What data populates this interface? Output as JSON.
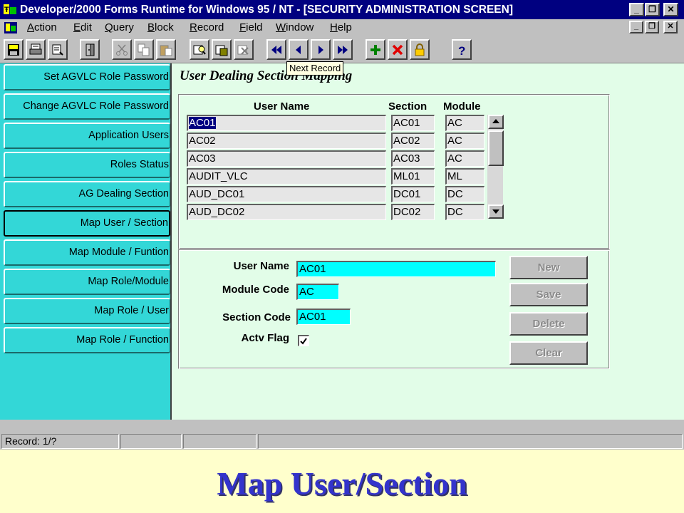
{
  "window": {
    "title": "Developer/2000 Forms Runtime for Windows 95 / NT - [SECURITY ADMINISTRATION SCREEN]",
    "app_icon": "forms-runtime-icon",
    "controls": [
      "minimize-icon",
      "restore-icon",
      "close-icon"
    ]
  },
  "menubar": {
    "items": [
      "Action",
      "Edit",
      "Query",
      "Block",
      "Record",
      "Field",
      "Window",
      "Help"
    ]
  },
  "toolbar": {
    "icons": [
      "save-icon",
      "print-icon",
      "print-setup-icon",
      "exit-icon",
      "cut-icon",
      "copy-icon",
      "paste-icon",
      "enter-query-icon",
      "execute-query-icon",
      "cancel-query-icon",
      "first-record-icon",
      "previous-record-icon",
      "next-record-icon",
      "last-record-icon",
      "insert-record-icon",
      "delete-record-icon",
      "lock-record-icon",
      "help-icon"
    ],
    "tooltip": "Next Record"
  },
  "sidebar": {
    "items": [
      {
        "label": "Set AGVLC Role Password"
      },
      {
        "label": "Change AGVLC Role Password"
      },
      {
        "label": "Application Users"
      },
      {
        "label": "Roles Status"
      },
      {
        "label": "AG Dealing Section"
      },
      {
        "label": "Map User / Section"
      },
      {
        "label": "Map Module / Funtion"
      },
      {
        "label": "Map Role/Module"
      },
      {
        "label": "Map Role / User"
      },
      {
        "label": "Map Role / Function"
      }
    ],
    "active_index": 5
  },
  "main": {
    "heading": "User Dealing Section Mapping",
    "table": {
      "columns": [
        "User Name",
        "Section",
        "Module"
      ],
      "rows": [
        [
          "AC01",
          "AC01",
          "AC"
        ],
        [
          "AC02",
          "AC02",
          "AC"
        ],
        [
          "AC03",
          "AC03",
          "AC"
        ],
        [
          "AUDIT_VLC",
          "ML01",
          "ML"
        ],
        [
          "AUD_DC01",
          "DC01",
          "DC"
        ],
        [
          "AUD_DC02",
          "DC02",
          "DC"
        ]
      ],
      "selected_row": 0
    },
    "form": {
      "user_name_label": "User Name",
      "user_name_value": "AC01",
      "module_code_label": "Module Code",
      "module_code_value": "AC",
      "section_code_label": "Section Code",
      "section_code_value": "AC01",
      "actv_flag_label": "Actv Flag",
      "actv_flag_checked": true
    },
    "buttons": {
      "new": "New",
      "save": "Save",
      "delete": "Delete",
      "clear": "Clear"
    }
  },
  "statusbar": {
    "record": "Record: 1/?"
  },
  "caption": "Map User/Section",
  "colors": {
    "title_bar": "#000080",
    "sidebar": "#33d7d7",
    "content_bg": "#e2fde8",
    "input_bg": "#00ffff",
    "caption": "#3333cc",
    "slide_bg": "#ffffcc"
  }
}
